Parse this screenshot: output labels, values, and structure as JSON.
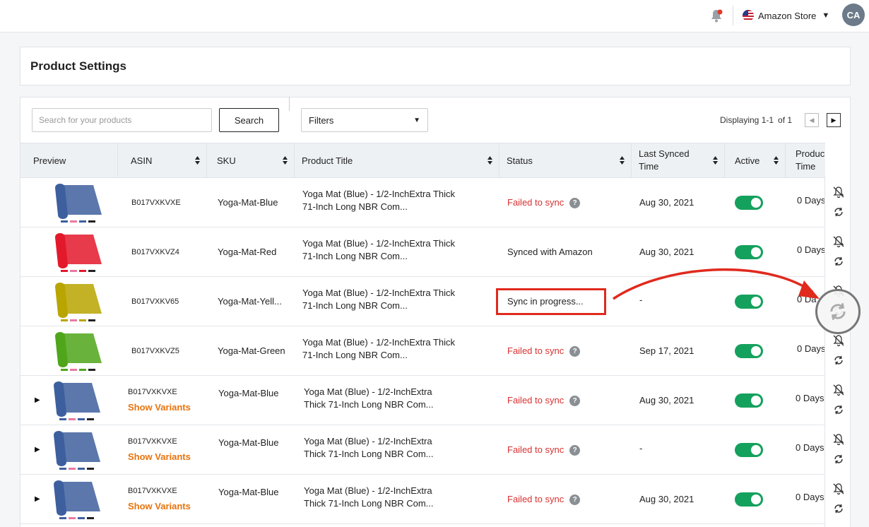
{
  "topbar": {
    "store_name": "Amazon Store",
    "avatar_initials": "CA",
    "notification_dot_color": "#e0392b"
  },
  "page": {
    "title": "Product Settings"
  },
  "toolbar": {
    "search_placeholder": "Search for your products",
    "search_value": "",
    "search_button": "Search",
    "filters_label": "Filters",
    "displaying": "Displaying 1-1",
    "of_label": "of 1"
  },
  "columns": {
    "preview": "Preview",
    "asin": "ASIN",
    "sku": "SKU",
    "title": "Product Title",
    "status": "Status",
    "last_synced_l1": "Last Synced",
    "last_synced_l2": "Time",
    "active": "Active",
    "product_time_l1": "Produc",
    "product_time_l2": "Time"
  },
  "rows": [
    {
      "asin": "B017VXKVXE",
      "sku": "Yoga-Mat-Blue",
      "title_l1": "Yoga Mat (Blue) - 1/2-InchExtra Thick",
      "title_l2": "71-Inch Long NBR Com...",
      "status": "Failed to sync",
      "last_synced": "Aug 30, 2021",
      "active": true,
      "product_time": "0 Days",
      "mat_color": "#3e5f9e",
      "has_variants": false
    },
    {
      "asin": "B017VXKVZ4",
      "sku": "Yoga-Mat-Red",
      "title_l1": "Yoga Mat (Blue) - 1/2-InchExtra Thick",
      "title_l2": "71-Inch Long NBR Com...",
      "status": "Synced with Amazon",
      "last_synced": "Aug 30, 2021",
      "active": true,
      "product_time": "0 Days",
      "mat_color": "#e3192b",
      "has_variants": false
    },
    {
      "asin": "B017VXKV65",
      "sku": "Yoga-Mat-Yell...",
      "title_l1": "Yoga Mat (Blue) - 1/2-InchExtra Thick",
      "title_l2": "71-Inch Long NBR Com...",
      "status": "Sync in progress...",
      "last_synced": "-",
      "active": true,
      "product_time": "0 Da",
      "mat_color": "#b8a500",
      "has_variants": false
    },
    {
      "asin": "B017VXKVZ5",
      "sku": "Yoga-Mat-Green",
      "title_l1": "Yoga Mat (Blue) - 1/2-InchExtra Thick",
      "title_l2": "71-Inch Long NBR Com...",
      "status": "Failed to sync",
      "last_synced": "Sep 17, 2021",
      "active": true,
      "product_time": "0 Days",
      "mat_color": "#4fa61a",
      "has_variants": false
    },
    {
      "asin": "B017VXKVXE",
      "sku": "Yoga-Mat-Blue",
      "title_l1": "Yoga Mat (Blue) - 1/2-InchExtra",
      "title_l2": "Thick 71-Inch Long NBR Com...",
      "status": "Failed to sync",
      "last_synced": "Aug 30, 2021",
      "active": true,
      "product_time": "0 Days",
      "mat_color": "#3e5f9e",
      "has_variants": true,
      "variants_label": "Show Variants"
    },
    {
      "asin": "B017VXKVXE",
      "sku": "Yoga-Mat-Blue",
      "title_l1": "Yoga Mat (Blue) - 1/2-InchExtra",
      "title_l2": "Thick 71-Inch Long NBR Com...",
      "status": "Failed to sync",
      "last_synced": "-",
      "active": true,
      "product_time": "0 Days",
      "mat_color": "#3e5f9e",
      "has_variants": true,
      "variants_label": "Show Variants"
    },
    {
      "asin": "B017VXKVXE",
      "sku": "Yoga-Mat-Blue",
      "title_l1": "Yoga Mat (Blue) - 1/2-InchExtra",
      "title_l2": "Thick 71-Inch Long NBR Com...",
      "status": "Failed to sync",
      "last_synced": "Aug 30, 2021",
      "active": true,
      "product_time": "0 Days",
      "mat_color": "#3e5f9e",
      "has_variants": true,
      "variants_label": "Show Variants"
    }
  ],
  "colors": {
    "failed": "#d93030",
    "toggle_on": "#14a15d",
    "variants": "#e8730c",
    "annotation": "#e02a1e"
  },
  "icons": {
    "row_actions": [
      "bell-off-icon",
      "sync-icon"
    ],
    "annotation": "curved-arrow",
    "zoom": "sync-icon"
  }
}
